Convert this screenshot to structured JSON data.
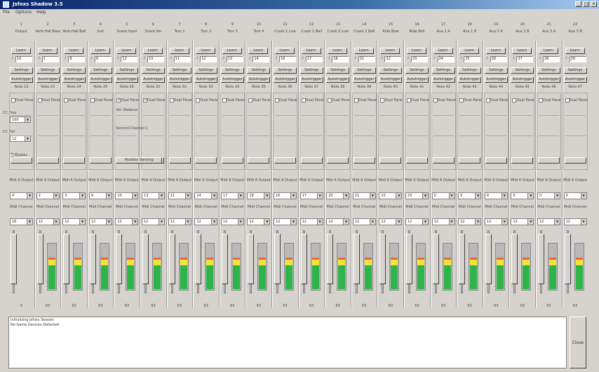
{
  "window": {
    "title": "Jsfoxs Shadow 3.5"
  },
  "menu": [
    "File",
    "Options",
    "Help"
  ],
  "left": {
    "cc_prev_label": "CC Prev",
    "cc_prev_value": "100",
    "cc_hot_label": "CC Hot",
    "cc_hot_value": "12",
    "bypass_label": "Bypass"
  },
  "strips": [
    {
      "num": "1",
      "name": "Output",
      "learn": "Learn",
      "num_val": "10",
      "settings": "Settings",
      "autotrigger": "Autotrigger",
      "note": "Note 22",
      "dual": "Dual Param",
      "dual_checked": false,
      "midi_out": "Midi A Output",
      "out_sel": "4",
      "midi_ch": "Midi Channel",
      "ch_sel": "16",
      "level": 0.0,
      "value": "0"
    },
    {
      "num": "2",
      "name": "Verb-Hall Bass",
      "learn": "Learn",
      "num_val": "1",
      "settings": "Settings",
      "autotrigger": "Autotrigger",
      "note": "Note 23",
      "dual": "Dual Param",
      "dual_checked": false,
      "midi_out": "Midi A Output",
      "out_sel": "2",
      "midi_ch": "Midi Channel",
      "ch_sel": "12",
      "level": 0.72,
      "value": "63"
    },
    {
      "num": "3",
      "name": "Verb-Hall Ball",
      "learn": "Learn",
      "num_val": "8",
      "settings": "Settings",
      "autotrigger": "Autotrigger",
      "note": "Note 24",
      "dual": "Dual Param",
      "dual_checked": false,
      "midi_out": "Midi A Output",
      "out_sel": "3",
      "midi_ch": "Midi Channel",
      "ch_sel": "12",
      "level": 0.72,
      "value": "63"
    },
    {
      "num": "4",
      "name": "Inst",
      "learn": "Learn",
      "num_val": "9",
      "settings": "Settings",
      "autotrigger": "Autotrigger",
      "note": "Note 25",
      "dual": "Dual Param",
      "dual_checked": false,
      "midi_out": "Midi A Output",
      "out_sel": "9",
      "midi_ch": "Midi Channel",
      "ch_sel": "12",
      "level": 0.72,
      "value": "63"
    },
    {
      "num": "5",
      "name": "Snare Input",
      "learn": "Learn",
      "num_val": "12",
      "settings": "Settings",
      "autotrigger": "Autotrigger",
      "note": "Note 26",
      "dual": "Dual Param",
      "dual_checked": true,
      "midi_out": "Midi A Output",
      "out_sel": "10",
      "midi_ch": "Midi Channel",
      "ch_sel": "12",
      "level": 0.72,
      "value": "63"
    },
    {
      "num": "6",
      "name": "Snare Ver",
      "learn": "Learn",
      "num_val": "13",
      "settings": "Settings",
      "autotrigger": "Autotrigger",
      "note": "Note 30",
      "dual": "Dual Param",
      "dual_checked": true,
      "midi_out": "Midi A Output",
      "out_sel": "13",
      "midi_ch": "Midi Channel",
      "ch_sel": "12",
      "level": 0.72,
      "value": "63"
    },
    {
      "num": "7",
      "name": "Tom 1",
      "learn": "Learn",
      "num_val": "11",
      "settings": "Settings",
      "autotrigger": "Autotrigger",
      "note": "Note 32",
      "dual": "Dual Param",
      "dual_checked": false,
      "midi_out": "Midi A Output",
      "out_sel": "11",
      "midi_ch": "Midi Channel",
      "ch_sel": "12",
      "level": 0.72,
      "value": "63"
    },
    {
      "num": "8",
      "name": "Tom 2",
      "learn": "Learn",
      "num_val": "12",
      "settings": "Settings",
      "autotrigger": "Autotrigger",
      "note": "Note 33",
      "dual": "Dual Param",
      "dual_checked": false,
      "midi_out": "Midi A Output",
      "out_sel": "14",
      "midi_ch": "Midi Channel",
      "ch_sel": "12",
      "level": 0.72,
      "value": "63"
    },
    {
      "num": "9",
      "name": "Tom 3",
      "learn": "Learn",
      "num_val": "13",
      "settings": "Settings",
      "autotrigger": "Autotrigger",
      "note": "Note 34",
      "dual": "Dual Param",
      "dual_checked": false,
      "midi_out": "Midi A Output",
      "out_sel": "17",
      "midi_ch": "Midi Channel",
      "ch_sel": "12",
      "level": 0.72,
      "value": "63"
    },
    {
      "num": "10",
      "name": "Tom 4",
      "learn": "Learn",
      "num_val": "14",
      "settings": "Settings",
      "autotrigger": "Autotrigger",
      "note": "Note 35",
      "dual": "Dual Param",
      "dual_checked": false,
      "midi_out": "Midi A Output",
      "out_sel": "18",
      "midi_ch": "Midi Channel",
      "ch_sel": "12",
      "level": 0.72,
      "value": "63"
    },
    {
      "num": "11",
      "name": "Crash 1 Low",
      "learn": "Learn",
      "num_val": "16",
      "settings": "Settings",
      "autotrigger": "Autotrigger",
      "note": "Note 36",
      "dual": "Dual Param",
      "dual_checked": false,
      "midi_out": "Midi A Output",
      "out_sel": "16",
      "midi_ch": "Midi Channel",
      "ch_sel": "12",
      "level": 0.72,
      "value": "63"
    },
    {
      "num": "12",
      "name": "Crash 1 Bell",
      "learn": "Learn",
      "num_val": "17",
      "settings": "Settings",
      "autotrigger": "Autotrigger",
      "note": "Note 37",
      "dual": "Dual Param",
      "dual_checked": false,
      "midi_out": "Midi A Output",
      "out_sel": "17",
      "midi_ch": "Midi Channel",
      "ch_sel": "12",
      "level": 0.72,
      "value": "63"
    },
    {
      "num": "13",
      "name": "Crash 2 Low",
      "learn": "Learn",
      "num_val": "18",
      "settings": "Settings",
      "autotrigger": "Autotrigger",
      "note": "Note 38",
      "dual": "Dual Param",
      "dual_checked": false,
      "midi_out": "Midi A Output",
      "out_sel": "20",
      "midi_ch": "Midi Channel",
      "ch_sel": "12",
      "level": 0.72,
      "value": "63"
    },
    {
      "num": "14",
      "name": "Crash 2 Bell",
      "learn": "Learn",
      "num_val": "21",
      "settings": "Settings",
      "autotrigger": "Autotrigger",
      "note": "Note 39",
      "dual": "Dual Param",
      "dual_checked": false,
      "midi_out": "Midi A Output",
      "out_sel": "21",
      "midi_ch": "Midi Channel",
      "ch_sel": "12",
      "level": 0.72,
      "value": "63"
    },
    {
      "num": "15",
      "name": "Ride Bow",
      "learn": "Learn",
      "num_val": "22",
      "settings": "Settings",
      "autotrigger": "Autotrigger",
      "note": "Note 40",
      "dual": "Dual Param",
      "dual_checked": false,
      "midi_out": "Midi A Output",
      "out_sel": "22",
      "midi_ch": "Midi Channel",
      "ch_sel": "12",
      "level": 0.72,
      "value": "63"
    },
    {
      "num": "16",
      "name": "Ride Bell",
      "learn": "Learn",
      "num_val": "23",
      "settings": "Settings",
      "autotrigger": "Autotrigger",
      "note": "Note 41",
      "dual": "Dual Param",
      "dual_checked": false,
      "midi_out": "Midi A Output",
      "out_sel": "23",
      "midi_ch": "Midi Channel",
      "ch_sel": "12",
      "level": 0.72,
      "value": "63"
    },
    {
      "num": "17",
      "name": "Aux 1 A",
      "learn": "Learn",
      "num_val": "24",
      "settings": "Settings",
      "autotrigger": "Autotrigger",
      "note": "Note 42",
      "dual": "Dual Param",
      "dual_checked": false,
      "midi_out": "Midi A Output",
      "out_sel": "0",
      "midi_ch": "Midi Channel",
      "ch_sel": "12",
      "level": 0.72,
      "value": "63"
    },
    {
      "num": "18",
      "name": "Aux 1 B",
      "learn": "Learn",
      "num_val": "25",
      "settings": "Settings",
      "autotrigger": "Autotrigger",
      "note": "Note 43",
      "dual": "Dual Param",
      "dual_checked": false,
      "midi_out": "Midi A Output",
      "out_sel": "0",
      "midi_ch": "Midi Channel",
      "ch_sel": "12",
      "level": 0.72,
      "value": "63"
    },
    {
      "num": "19",
      "name": "Aux 2 A",
      "learn": "Learn",
      "num_val": "26",
      "settings": "Settings",
      "autotrigger": "Autotrigger",
      "note": "Note 44",
      "dual": "Dual Param",
      "dual_checked": false,
      "midi_out": "Midi A Output",
      "out_sel": "0",
      "midi_ch": "Midi Channel",
      "ch_sel": "12",
      "level": 0.72,
      "value": "63"
    },
    {
      "num": "20",
      "name": "Aux 2 B",
      "learn": "Learn",
      "num_val": "27",
      "settings": "Settings",
      "autotrigger": "Autotrigger",
      "note": "Note 45",
      "dual": "Dual Param",
      "dual_checked": false,
      "midi_out": "Midi A Output",
      "out_sel": "0",
      "midi_ch": "Midi Channel",
      "ch_sel": "12",
      "level": 0.72,
      "value": "63"
    },
    {
      "num": "21",
      "name": "Aux 3 A",
      "learn": "Learn",
      "num_val": "28",
      "settings": "Settings",
      "autotrigger": "Autotrigger",
      "note": "Note 46",
      "dual": "Dual Param",
      "dual_checked": false,
      "midi_out": "Midi A Output",
      "out_sel": "0",
      "midi_ch": "Midi Channel",
      "ch_sel": "12",
      "level": 0.72,
      "value": "63"
    },
    {
      "num": "22",
      "name": "Aux 3 B",
      "learn": "Learn",
      "num_val": "29",
      "settings": "Settings",
      "autotrigger": "Autotrigger",
      "note": "Note 47",
      "dual": "Dual Param",
      "dual_checked": false,
      "midi_out": "Midi A Output",
      "out_sel": "0",
      "midi_ch": "Midi Channel",
      "ch_sel": "12",
      "level": 0.72,
      "value": "63"
    }
  ],
  "dual_extra": {
    "vel_balance": "Vel. Balance",
    "vel_val": "0%",
    "second_ch": "Second Channel 1",
    "pos_sensing": "Position Sensing"
  },
  "log": {
    "lines": [
      "Initializing Jsfoxs Session",
      "No Game Devices Detected"
    ]
  },
  "close": "Close",
  "colors": {
    "meter_green": "#2db54a",
    "meter_yellow": "#f2e23a",
    "meter_red": "#e06b3a"
  }
}
